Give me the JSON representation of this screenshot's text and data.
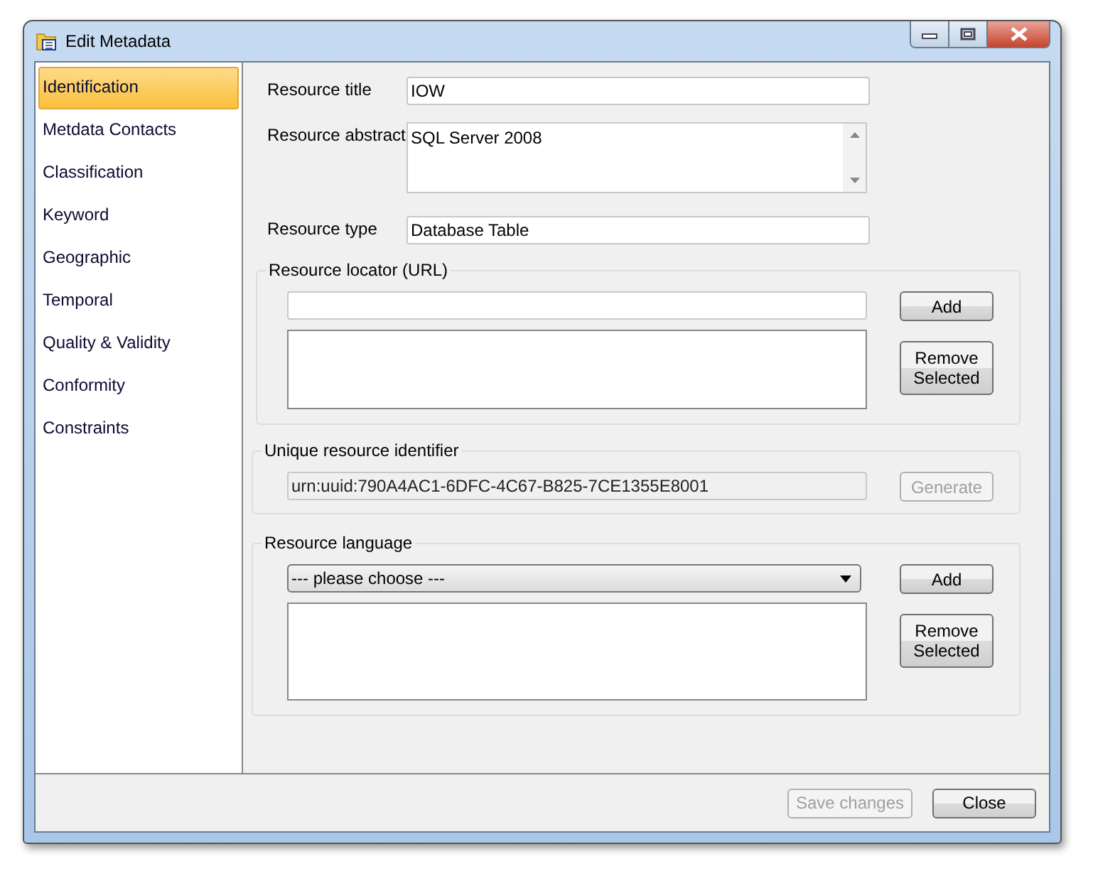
{
  "window": {
    "title": "Edit Metadata"
  },
  "sidebar": {
    "items": [
      {
        "label": "Identification",
        "selected": true
      },
      {
        "label": "Metdata Contacts",
        "selected": false
      },
      {
        "label": "Classification",
        "selected": false
      },
      {
        "label": "Keyword",
        "selected": false
      },
      {
        "label": "Geographic",
        "selected": false
      },
      {
        "label": "Temporal",
        "selected": false
      },
      {
        "label": "Quality & Validity",
        "selected": false
      },
      {
        "label": "Conformity",
        "selected": false
      },
      {
        "label": "Constraints",
        "selected": false
      }
    ]
  },
  "fields": [
    {
      "kind": "text",
      "label": "Resource title",
      "value": "IOW"
    },
    {
      "kind": "multiline",
      "label": "Resource abstract",
      "value": "SQL Server 2008"
    },
    {
      "kind": "text",
      "label": "Resource type",
      "value": "Database Table"
    }
  ],
  "locator_group": {
    "legend": "Resource locator (URL)",
    "add_button": {
      "label": "Add",
      "disabled": false
    },
    "remove_button": {
      "label": "Remove Selected",
      "disabled": false
    }
  },
  "identifier_group": {
    "legend": "Unique resource identifier",
    "value": "urn:uuid:790A4AC1-6DFC-4C67-B825-7CE1355E8001",
    "generate_button": {
      "label": "Generate",
      "disabled": true
    }
  },
  "language_group": {
    "legend": "Resource language",
    "dropdown": {
      "value": "--- please choose ---"
    },
    "add_button": {
      "label": "Add",
      "disabled": false
    },
    "remove_button": {
      "label": "Remove Selected",
      "disabled": false
    }
  },
  "footer": {
    "buttons": [
      {
        "label": "Save changes",
        "disabled": true
      },
      {
        "label": "Close",
        "disabled": false
      }
    ]
  }
}
